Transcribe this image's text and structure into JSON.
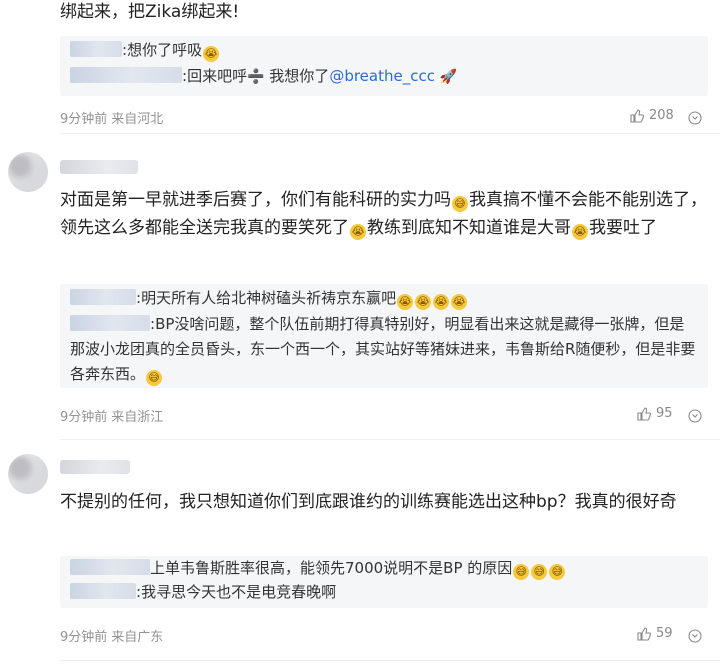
{
  "comments": [
    {
      "text": "绑起来，把Zika绑起来!",
      "replies": [
        {
          "sep": ":",
          "text": "想你了呼吸",
          "emoji": [
            "😭"
          ]
        },
        {
          "sep": ":",
          "text_a": "回来吧呼",
          "text_b": "我想你了",
          "mention": "@breathe_ccc",
          "emoji_after": "🚀"
        }
      ],
      "time": "9分钟前",
      "location": "来自河北",
      "likes": "208"
    },
    {
      "text_a": "对面是第一早就进季后赛了，你们有能科研的实力吗",
      "text_b": "我真搞不懂不会能不能别选了，领先这么多都能全送完我真的要笑死了",
      "text_c": "教练到底知不知道谁是大哥",
      "text_d": "我要吐了",
      "replies": [
        {
          "sep": ":",
          "text": "明天所有人给北神树磕头祈祷京东赢吧"
        },
        {
          "sep": ":",
          "text": "BP没啥问题，整个队伍前期打得真特别好，明显看出来这就是藏得一张牌，但是那波小龙团真的全员昏头，东一个西一个，其实站好等猪妹进来，韦鲁斯给R随便秒，但是非要各奔东西。"
        }
      ],
      "time": "9分钟前",
      "location": "来自浙江",
      "likes": "95"
    },
    {
      "text": "不提别的任何，我只想知道你们到底跟谁约的训练赛能选出这种bp？我真的很好奇",
      "replies": [
        {
          "sep": ":",
          "text": "上单韦鲁斯胜率很高，能领先7000说明不是BP 的原因"
        },
        {
          "sep": ":",
          "text": "我寻思今天也不是电竞春晚啊"
        }
      ],
      "time": "9分钟前",
      "location": "来自广东",
      "likes": "59"
    }
  ],
  "icons": {
    "like": "thumbs-up-icon",
    "more": "more-icon"
  },
  "colors": {
    "mention": "#2a6bd1",
    "meta": "#939393",
    "reply_bg": "#f5f6f8"
  }
}
